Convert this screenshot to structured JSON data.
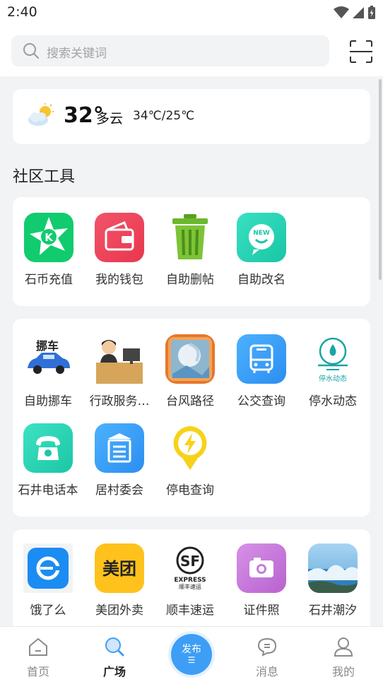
{
  "status_bar": {
    "time": "2:40"
  },
  "search": {
    "placeholder": "搜索关键词"
  },
  "weather": {
    "temp": "32°",
    "condition": "多云",
    "range": "34℃/25℃"
  },
  "section_title": "社区工具",
  "tools": [
    {
      "label": "石币充值",
      "icon": "coin-recharge-icon"
    },
    {
      "label": "我的钱包",
      "icon": "wallet-icon"
    },
    {
      "label": "自助删帖",
      "icon": "trash-icon"
    },
    {
      "label": "自助改名",
      "icon": "new-name-icon"
    }
  ],
  "services": [
    {
      "label": "自助挪车",
      "icon": "move-car-icon",
      "icon_text": "挪车"
    },
    {
      "label": "行政服务…",
      "icon": "admin-service-icon"
    },
    {
      "label": "台风路径",
      "icon": "typhoon-icon"
    },
    {
      "label": "公交查询",
      "icon": "bus-icon"
    },
    {
      "label": "停水动态",
      "icon": "water-outage-icon",
      "icon_text": "停水动态"
    },
    {
      "label": "石井电话本",
      "icon": "phone-book-icon"
    },
    {
      "label": "居村委会",
      "icon": "village-committee-icon"
    },
    {
      "label": "停电查询",
      "icon": "power-outage-icon"
    }
  ],
  "life": [
    {
      "label": "饿了么",
      "icon": "eleme-icon"
    },
    {
      "label": "美团外卖",
      "icon": "meituan-icon",
      "icon_text": "美团"
    },
    {
      "label": "顺丰速运",
      "icon": "sf-express-icon",
      "icon_text": "SF",
      "icon_sub": "EXPRESS",
      "icon_sub2": "顺丰速运"
    },
    {
      "label": "证件照",
      "icon": "id-photo-icon"
    },
    {
      "label": "石井潮汐",
      "icon": "tide-icon"
    }
  ],
  "nav": {
    "home": "首页",
    "square": "广场",
    "publish": "发布",
    "messages": "消息",
    "mine": "我的"
  },
  "colors": {
    "accent": "#3e9ef5",
    "background": "#f2f3f5"
  }
}
